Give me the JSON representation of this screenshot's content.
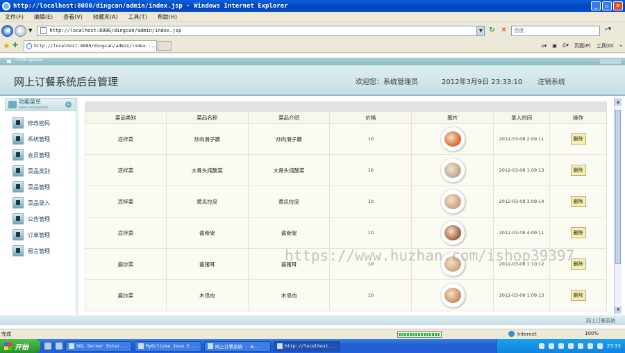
{
  "window": {
    "title": "http://localhost:8080/dingcan/admin/index.jsp - Windows Internet Explorer",
    "buttons": [
      "_",
      "▫",
      "✕"
    ]
  },
  "menubar": [
    "文件(F)",
    "编辑(E)",
    "查看(V)",
    "收藏夹(A)",
    "工具(T)",
    "帮助(H)"
  ],
  "address": {
    "url": "http://localhost:8080/dingcan/admin/index.jsp",
    "search_placeholder": "百度"
  },
  "tab": {
    "title": "http://localhost:8080/dingcan/admin/index....",
    "page_menu": "页面(P)",
    "tools_menu": "工具(O)"
  },
  "app": {
    "strip_label": "LTES system",
    "system_name": "网上订餐系统后台管理",
    "welcome": "欢迎您：系统管理员",
    "datetime": "2012年3月9日  23:33:10",
    "logout": "注销系统",
    "footer": "网上订餐系统"
  },
  "sidebar": {
    "title": "功能菜单",
    "subtitle": "menu·navigation",
    "items": [
      "修改密码",
      "系统管理",
      "会员管理",
      "菜品类别",
      "菜品管理",
      "菜品录入",
      "公告管理",
      "订单管理",
      "留言管理"
    ]
  },
  "table": {
    "columns": [
      "菜品类别",
      "菜品名称",
      "菜品介绍",
      "价格",
      "图片",
      "录入时间",
      "操作"
    ],
    "delete_label": "删除",
    "rows": [
      {
        "category": "凉拌菜",
        "name": "炒肉滑子蘑",
        "desc": "炒肉滑子蘑",
        "price": "10",
        "time": "2012-03-08 2:09:11",
        "color": "#d9612e"
      },
      {
        "category": "凉拌菜",
        "name": "大骨头炖酸菜",
        "desc": "大骨头炖酸菜",
        "price": "10",
        "time": "2012-03-08 1:09:13",
        "color": "#b7a68e"
      },
      {
        "category": "凉拌菜",
        "name": "黄瓜拉皮",
        "desc": "黄瓜拉皮",
        "price": "10",
        "time": "2012-03-08 3:09:14",
        "color": "#c8a17a"
      },
      {
        "category": "凉拌菜",
        "name": "酱骨架",
        "desc": "酱骨架",
        "price": "10",
        "time": "2012-03-08 4:09:11",
        "color": "#9e5a3a"
      },
      {
        "category": "酱炒菜",
        "name": "酱猪耳",
        "desc": "酱猪耳",
        "price": "10",
        "time": "2012-03-08 1:10:12",
        "color": "#c9a27c"
      },
      {
        "category": "酱炒菜",
        "name": "木须肉",
        "desc": "木须肉",
        "price": "10",
        "time": "2012-03-08 1:09:13",
        "color": "#c98a5a"
      }
    ]
  },
  "status": {
    "text": "完成",
    "zone": "Internet",
    "zoom": "100%"
  },
  "taskbar": {
    "start": "开始",
    "tasks": [
      "SQL Server Enter...",
      "MyEclipse Java E...",
      "网上订餐系统 - W...",
      "http://localhost..."
    ],
    "clock": "23:33"
  },
  "watermark": "https://www.huzhan.com/ishop39397"
}
